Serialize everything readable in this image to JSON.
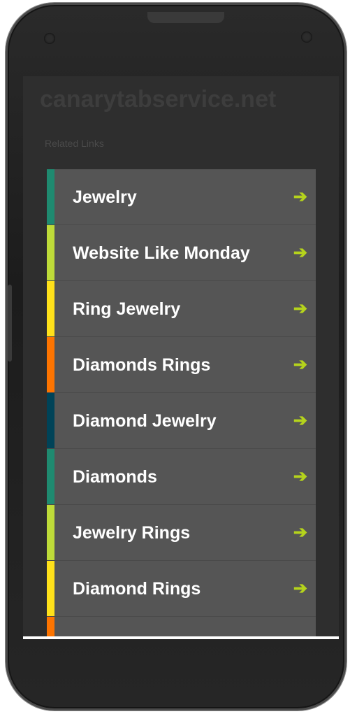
{
  "site": {
    "title": "canarytabservice.net",
    "related_label": "Related Links"
  },
  "links": [
    {
      "label": "Jewelry",
      "accent": "#1f8a70"
    },
    {
      "label": "Website Like Monday",
      "accent": "#bedb39"
    },
    {
      "label": "Ring Jewelry",
      "accent": "#ffe11a"
    },
    {
      "label": "Diamonds Rings",
      "accent": "#fd7400"
    },
    {
      "label": "Diamond Jewelry",
      "accent": "#004358"
    },
    {
      "label": "Diamonds",
      "accent": "#1f8a70"
    },
    {
      "label": "Jewelry Rings",
      "accent": "#bedb39"
    },
    {
      "label": "Diamond Rings",
      "accent": "#ffe11a"
    },
    {
      "label": "",
      "accent": "#fd7400"
    }
  ],
  "arrow_icon": "right-arrow-icon",
  "colors": {
    "arrow": "#b5d31c",
    "item_background": "#555555",
    "screen_background": "#2e2e2e"
  }
}
